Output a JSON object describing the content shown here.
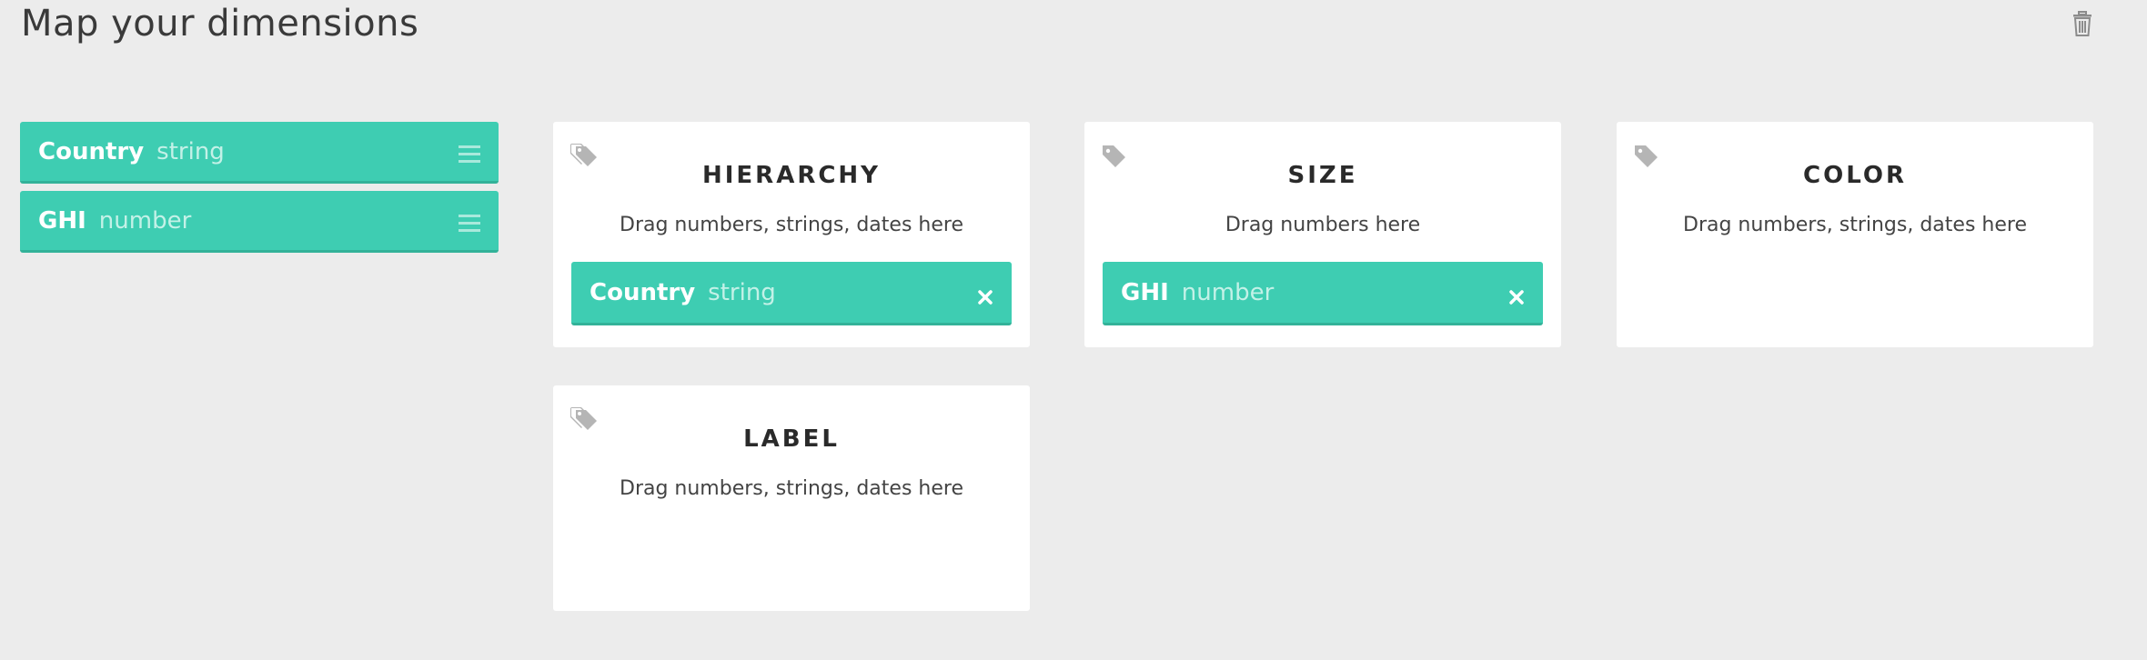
{
  "header": {
    "title": "Map your dimensions"
  },
  "dimensions": [
    {
      "name": "Country",
      "type": "string"
    },
    {
      "name": "GHI",
      "type": "number"
    }
  ],
  "cards": {
    "hierarchy": {
      "title": "HIERARCHY",
      "hint": "Drag numbers, strings, dates here",
      "mapped": {
        "name": "Country",
        "type": "string"
      }
    },
    "size": {
      "title": "SIZE",
      "hint": "Drag numbers here",
      "mapped": {
        "name": "GHI",
        "type": "number"
      }
    },
    "color": {
      "title": "COLOR",
      "hint": "Drag numbers, strings, dates here"
    },
    "label": {
      "title": "LABEL",
      "hint": "Drag numbers, strings, dates here"
    }
  },
  "colors": {
    "accent": "#3ecdb2",
    "background": "#ececec",
    "card": "#ffffff"
  },
  "icons": {
    "trash": "trash-icon",
    "tag": "tag-icon",
    "handle": "drag-handle-icon",
    "close": "close-icon"
  }
}
